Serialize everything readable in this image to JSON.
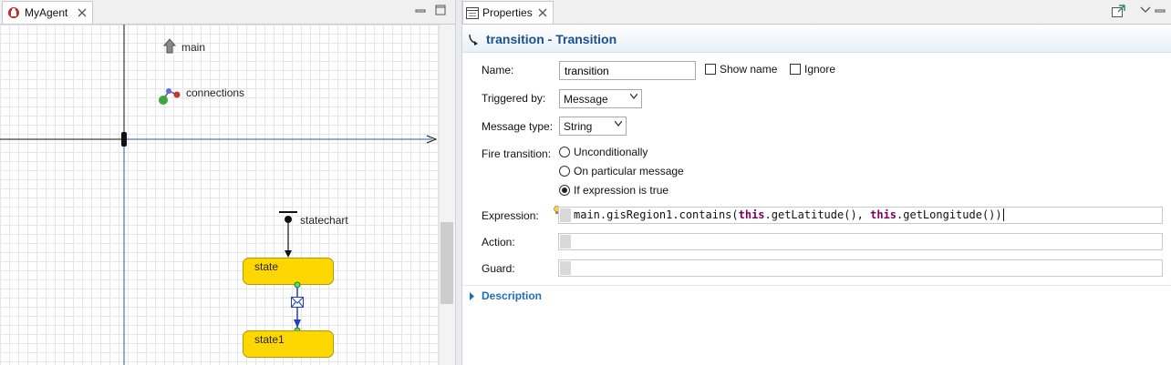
{
  "left_editor": {
    "tab_label": "MyAgent",
    "diagram": {
      "main_label": "main",
      "connections_label": "connections",
      "statechart_label": "statechart",
      "states": [
        "state",
        "state1"
      ]
    }
  },
  "properties": {
    "tab_label": "Properties",
    "title": "transition - Transition",
    "name": {
      "label": "Name:",
      "value": "transition"
    },
    "show_name": {
      "label": "Show name",
      "checked": false
    },
    "ignore": {
      "label": "Ignore",
      "checked": false
    },
    "triggered_by": {
      "label": "Triggered by:",
      "value": "Message"
    },
    "message_type": {
      "label": "Message type:",
      "value": "String"
    },
    "fire_transition": {
      "label": "Fire transition:",
      "options": [
        "Unconditionally",
        "On particular message",
        "If expression is true"
      ],
      "selected": "If expression is true"
    },
    "expression": {
      "label": "Expression:",
      "code_parts": [
        "main.gisRegion1.contains(",
        "this",
        ".getLatitude(), ",
        "this",
        ".getLongitude())"
      ]
    },
    "action": {
      "label": "Action:",
      "value": ""
    },
    "guard": {
      "label": "Guard:",
      "value": ""
    },
    "description_label": "Description"
  },
  "colors": {
    "state_fill": "#ffd700",
    "title_text": "#1c4f8f",
    "keyword": "#7f0055",
    "axis_blue": "#1f5fae"
  },
  "icons": [
    "agent-icon",
    "close-tab-icon",
    "minimize-icon",
    "maximize-icon",
    "properties-tab-icon",
    "open-in-new-icon",
    "view-menu-icon",
    "transition-icon",
    "main-arrow-icon",
    "connections-icon",
    "statechart-entry-icon",
    "message-trigger-icon",
    "lightbulb-icon",
    "expand-arrow-icon"
  ]
}
